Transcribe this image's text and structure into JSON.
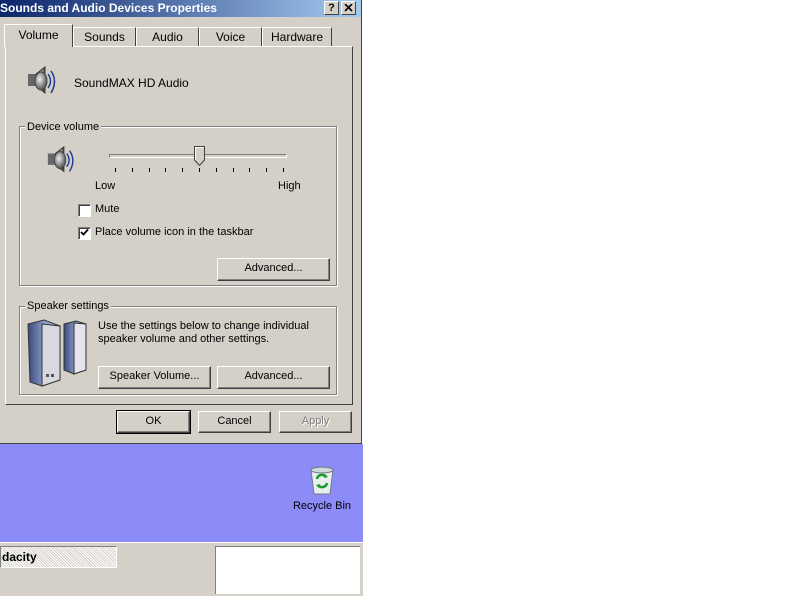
{
  "dialog": {
    "title": "Sounds and Audio Devices Properties",
    "help_button": "?",
    "close_button": "✕"
  },
  "tabs": [
    {
      "label": "Volume"
    },
    {
      "label": "Sounds"
    },
    {
      "label": "Audio"
    },
    {
      "label": "Voice"
    },
    {
      "label": "Hardware"
    }
  ],
  "device": {
    "name": "SoundMAX HD Audio",
    "icon": "speaker-icon"
  },
  "device_volume": {
    "group_label": "Device volume",
    "low_label": "Low",
    "high_label": "High",
    "level": 0.5,
    "mute_label": "Mute",
    "mute_checked": false,
    "taskbar_icon_label": "Place volume icon in the taskbar",
    "taskbar_icon_checked": true,
    "advanced_button": "Advanced..."
  },
  "speaker_settings": {
    "group_label": "Speaker settings",
    "description": "Use the settings below to change individual speaker volume and other settings.",
    "speaker_volume_button": "Speaker Volume...",
    "advanced_button": "Advanced...",
    "icon": "speakers-icon"
  },
  "footer": {
    "ok": "OK",
    "cancel": "Cancel",
    "apply": "Apply"
  },
  "desktop": {
    "background_color": "#8c8cf8",
    "recycle_bin_label": "Recycle Bin"
  },
  "taskbar": {
    "task_button_label": "dacity"
  }
}
